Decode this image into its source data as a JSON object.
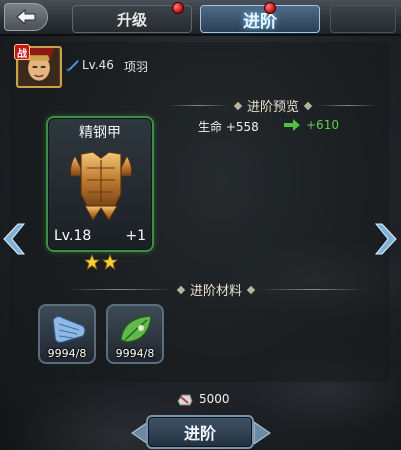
{
  "tabs": {
    "upgrade_label": "升级",
    "advance_label": "进阶"
  },
  "hero": {
    "battle_badge": "战",
    "level": "Lv.46",
    "name": "项羽"
  },
  "equipment": {
    "name": "精钢甲",
    "level": "Lv.18",
    "plus": "+1",
    "stars": 2,
    "border_color": "#3d8f47"
  },
  "preview": {
    "title": "进阶预览",
    "stat_current": "生命 +558",
    "stat_new": "+610",
    "new_color": "#5ad14a"
  },
  "materials": {
    "title": "进阶材料",
    "items": [
      {
        "icon": "blue-scroll-icon",
        "count": "9994/8"
      },
      {
        "icon": "green-leaf-icon",
        "count": "9994/8"
      }
    ]
  },
  "cost": {
    "icon": "silver-ingot-icon",
    "value": "5000"
  },
  "action": {
    "advance_button": "进阶"
  }
}
